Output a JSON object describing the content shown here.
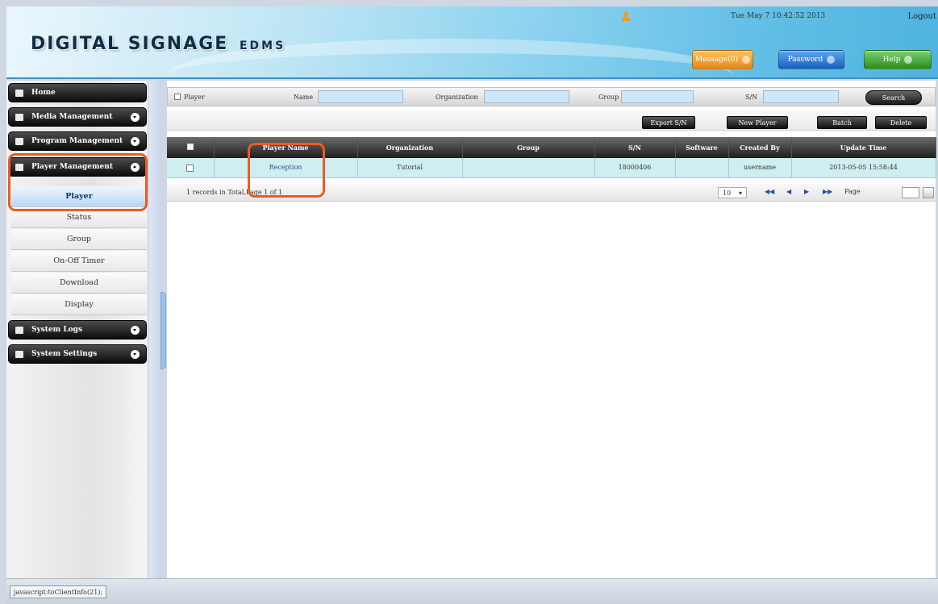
{
  "header": {
    "logo_main": "DIGITAL SIGNAGE",
    "logo_sub": "EDMS",
    "datetime": "Tue May 7 10:42:52 2013",
    "logout": "Logout",
    "message_btn": "Message(0)",
    "password_btn": "Password",
    "help_btn": "Help"
  },
  "sidebar": {
    "home": "Home",
    "media": "Media Management",
    "program": "Program Management",
    "player_mgmt": "Player Management",
    "sub_items": [
      "Player",
      "Status",
      "Group",
      "On-Off Timer",
      "Download",
      "Display"
    ],
    "system_logs": "System Logs",
    "system_settings": "System Settings"
  },
  "search": {
    "player_label": "Player",
    "name_label": "Name",
    "organization_label": "Organization",
    "group_label": "Group",
    "sn_label": "S/N",
    "search_btn": "Search"
  },
  "toolbar": {
    "export_sn": "Export S/N",
    "new_player": "New Player",
    "batch": "Batch",
    "delete": "Delete"
  },
  "table": {
    "headers": [
      "Player Name",
      "Organization",
      "Group",
      "S/N",
      "Software",
      "Created By",
      "Update Time"
    ],
    "rows": [
      {
        "name": "Reception",
        "organization": "Tutorial",
        "group": "",
        "sn": "18000406",
        "software": "",
        "created_by": "username",
        "update_time": "2013-05-05 15:58:44"
      }
    ]
  },
  "pager": {
    "summary": "1 records in Total,Page 1 of 1",
    "page_size": "10",
    "first": "◀◀",
    "prev": "◀",
    "next": "▶",
    "last": "▶▶",
    "page_label": "Page"
  },
  "status_bar": {
    "text": "javascript:toClientInfo(21);"
  },
  "colors": {
    "highlight": "#ef5a1f",
    "header_gradient_end": "#4eb3df",
    "row_bg": "#cfeef0"
  }
}
